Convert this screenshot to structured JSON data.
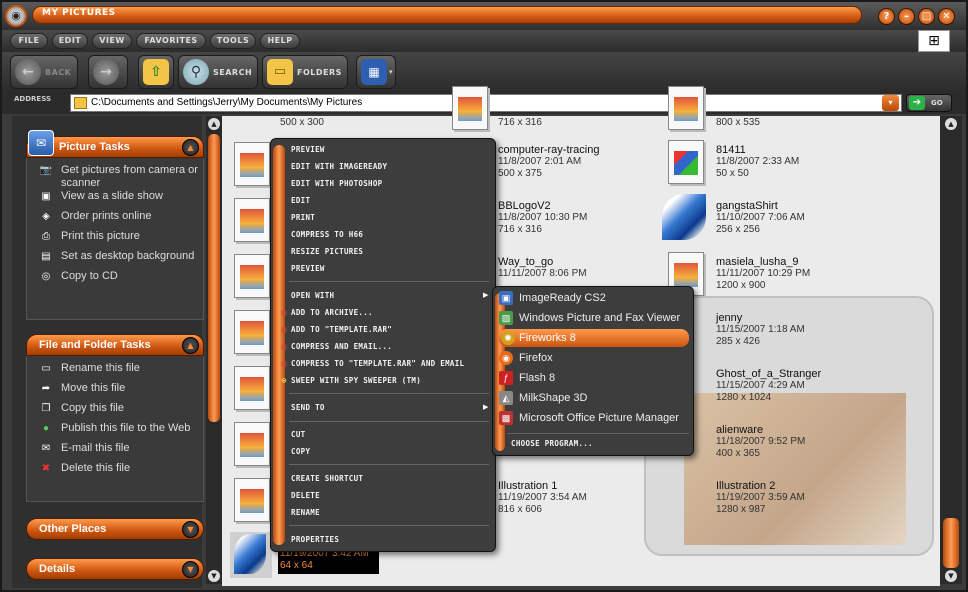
{
  "window": {
    "title": "MY PICTURES"
  },
  "menubar": [
    "FILE",
    "EDIT",
    "VIEW",
    "FAVORITES",
    "TOOLS",
    "HELP"
  ],
  "toolbar": {
    "back": "BACK",
    "search": "SEARCH",
    "folders": "FOLDERS"
  },
  "address": {
    "label": "ADDRESS",
    "value": "C:\\Documents and Settings\\Jerry\\My Documents\\My Pictures",
    "go": "GO"
  },
  "picture_tasks": {
    "title": "Picture Tasks",
    "items": [
      "Get pictures from camera or scanner",
      "View as a slide show",
      "Order prints online",
      "Print this picture",
      "Set as desktop background",
      "Copy to CD"
    ]
  },
  "file_tasks": {
    "title": "File and Folder Tasks",
    "items": [
      "Rename this file",
      "Move this file",
      "Copy this file",
      "Publish this file to the Web",
      "E-mail this file",
      "Delete this file"
    ]
  },
  "other_places": {
    "title": "Other Places"
  },
  "details": {
    "title": "Details"
  },
  "files": [
    {
      "name": "",
      "date": "",
      "size": "500 x 300"
    },
    {
      "name": "",
      "date": "",
      "size": "716 x 316"
    },
    {
      "name": "",
      "date": "",
      "size": "800 x 535"
    },
    {
      "name": "computer-ray-tracing",
      "date": "11/8/2007 2:01 AM",
      "size": "500 x 375"
    },
    {
      "name": "81411",
      "date": "11/8/2007 2:33 AM",
      "size": "50 x 50"
    },
    {
      "name": "BBLogoV2",
      "date": "11/8/2007 10:30 PM",
      "size": "716 x 316"
    },
    {
      "name": "gangstaShirt",
      "date": "11/10/2007 7:06 AM",
      "size": "256 x 256"
    },
    {
      "name": "Way_to_go",
      "date": "11/11/2007 8:06 PM",
      "size": ""
    },
    {
      "name": "masiela_lusha_9",
      "date": "11/11/2007 10:29 PM",
      "size": "1200 x 900"
    },
    {
      "name": "jenny",
      "date": "11/15/2007 1:18 AM",
      "size": "285 x 426"
    },
    {
      "name": "Ghost_of_a_Stranger",
      "date": "11/15/2007 4:29 AM",
      "size": "1280 x 1024"
    },
    {
      "name": "alienware",
      "date": "11/18/2007 9:52 PM",
      "size": "400 x 365"
    },
    {
      "name": "Illustration 1",
      "date": "11/19/2007 3:54 AM",
      "size": "816 x 606"
    },
    {
      "name": "Illustration 2",
      "date": "11/19/2007 3:59 AM",
      "size": "1280 x 987"
    }
  ],
  "selected_file": {
    "date": "11/19/2007 3:42 AM",
    "size": "64 x 64"
  },
  "context_menu": [
    "PREVIEW",
    "EDIT WITH IMAGEREADY",
    "EDIT WITH PHOTOSHOP",
    "EDIT",
    "PRINT",
    "COMPRESS TO H66",
    "RESIZE PICTURES",
    "PREVIEW",
    "OPEN WITH",
    "ADD TO ARCHIVE...",
    "ADD TO \"TEMPLATE.RAR\"",
    "COMPRESS AND EMAIL...",
    "COMPRESS TO \"TEMPLATE.RAR\" AND EMAIL",
    "SWEEP WITH SPY SWEEPER (TM)",
    "SEND TO",
    "CUT",
    "COPY",
    "CREATE SHORTCUT",
    "DELETE",
    "RENAME",
    "PROPERTIES"
  ],
  "open_with": [
    "ImageReady CS2",
    "Windows Picture and Fax Viewer",
    "Fireworks 8",
    "Firefox",
    "Flash 8",
    "MilkShape 3D",
    "Microsoft Office Picture Manager",
    "CHOOSE PROGRAM..."
  ],
  "colors": {
    "accent": "#e06a1c",
    "dark": "#3b3b3b"
  }
}
